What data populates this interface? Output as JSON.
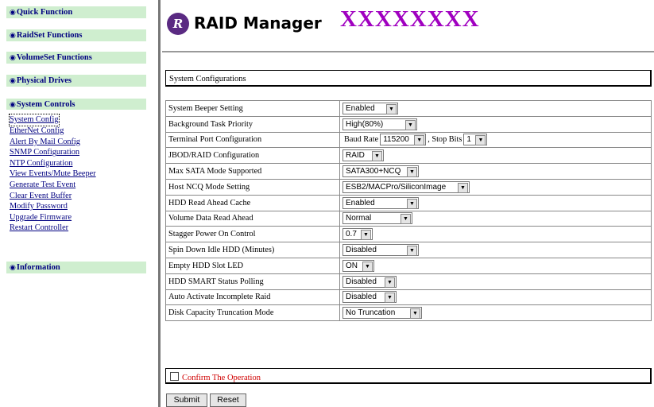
{
  "sidebar": {
    "sections": [
      {
        "label": "Quick Function"
      },
      {
        "label": "RaidSet Functions"
      },
      {
        "label": "VolumeSet Functions"
      },
      {
        "label": "Physical Drives"
      },
      {
        "label": "System Controls"
      },
      {
        "label": "Information"
      }
    ],
    "links": [
      "System Config",
      "EtherNet Config",
      "Alert By Mail Config",
      "SNMP Configuration",
      "NTP Configuration",
      "View Events/Mute Beeper",
      "Generate Test Event",
      "Clear Event Buffer",
      "Modify Password",
      "Upgrade Firmware",
      "Restart Controller"
    ]
  },
  "header": {
    "logo_text": "R",
    "title": "RAID Manager",
    "model": "XXXXXXXX"
  },
  "section_title": "System Configurations",
  "settings": [
    {
      "label": "System Beeper Setting",
      "value": "Enabled"
    },
    {
      "label": "Background Task Priority",
      "value": "High(80%)"
    },
    {
      "label": "Terminal Port Configuration",
      "baud_label": "Baud Rate",
      "baud_value": "115200",
      "stop_label": ", Stop Bits",
      "stop_value": "1"
    },
    {
      "label": "JBOD/RAID Configuration",
      "value": "RAID"
    },
    {
      "label": "Max SATA Mode Supported",
      "value": "SATA300+NCQ"
    },
    {
      "label": "Host NCQ Mode Setting",
      "value": "ESB2/MACPro/SiliconImage"
    },
    {
      "label": "HDD Read Ahead Cache",
      "value": "Enabled"
    },
    {
      "label": "Volume Data Read Ahead",
      "value": "Normal"
    },
    {
      "label": "Stagger Power On Control",
      "value": "0.7"
    },
    {
      "label": "Spin Down Idle HDD (Minutes)",
      "value": "Disabled"
    },
    {
      "label": "Empty HDD Slot LED",
      "value": "ON"
    },
    {
      "label": "HDD SMART Status Polling",
      "value": "Disabled"
    },
    {
      "label": "Auto Activate Incomplete Raid",
      "value": "Disabled"
    },
    {
      "label": "Disk Capacity Truncation Mode",
      "value": "No Truncation"
    }
  ],
  "confirm_label": "Confirm The Operation",
  "buttons": {
    "submit": "Submit",
    "reset": "Reset"
  }
}
